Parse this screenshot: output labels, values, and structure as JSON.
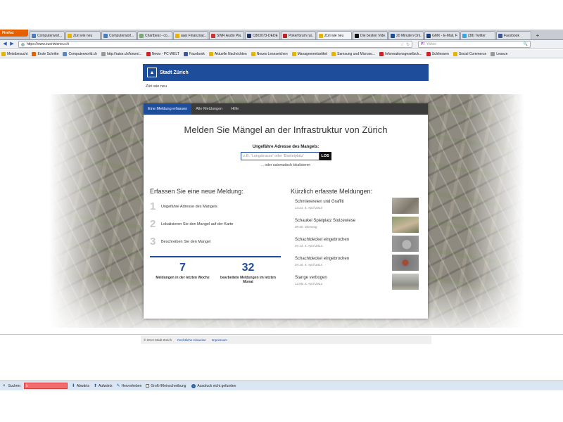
{
  "browser": {
    "app_button": "Firefox",
    "tabs": [
      {
        "title": "Computerworl..."
      },
      {
        "title": "Züri wie neu"
      },
      {
        "title": "Computerworl..."
      },
      {
        "title": "Chartbeat - co..."
      },
      {
        "title": "awp Finanznac..."
      },
      {
        "title": "SWR Audio Pla..."
      },
      {
        "title": "C803073-DEDE..."
      },
      {
        "title": "Pokerforum rai..."
      },
      {
        "title": "Züri wie neu"
      },
      {
        "title": "Die besten Vide..."
      },
      {
        "title": "20 Minuten Onl..."
      },
      {
        "title": "GMX - E-Mail, F..."
      },
      {
        "title": "(38) Twitter"
      },
      {
        "title": "Facebook"
      }
    ],
    "new_tab": "+",
    "url": "https://www.zueriwieneu.ch",
    "search_placeholder": "Yahoo",
    "search_engine": "Y!",
    "bookmarks": [
      {
        "label": "Meistbesucht"
      },
      {
        "label": "Erste Schritte"
      },
      {
        "label": "Computerworld.ch"
      },
      {
        "label": "http://raise.ch/forum/..."
      },
      {
        "label": "News - PC-WELT"
      },
      {
        "label": "Facebook"
      },
      {
        "label": "Aktuelle Nachrichten"
      },
      {
        "label": "Neues Lesezeichen"
      },
      {
        "label": "Managementartikel"
      },
      {
        "label": "Samsung und Microso..."
      },
      {
        "label": "Informationsgesellsch..."
      },
      {
        "label": "Schliessen"
      },
      {
        "label": "Social Commerce"
      },
      {
        "label": "Leseze"
      }
    ]
  },
  "site": {
    "header_title": "Stadt Zürich",
    "subtitle": "Züri wie neu",
    "nav": [
      {
        "label": "Eine Meldung erfassen"
      },
      {
        "label": "Alle Meldungen"
      },
      {
        "label": "Hilfe"
      }
    ],
    "headline": "Melden Sie Mängel an der Infrastruktur von Zürich",
    "address_label": "Ungefähre Adresse des Mangels:",
    "address_placeholder": "z.B. 'Langstrasse' oder 'Basteiplatz'",
    "go_button": "LOS",
    "auto_locate": "... oder automatisch lokalisieren",
    "left_heading": "Erfassen Sie eine neue Meldung:",
    "steps": [
      {
        "num": "1",
        "text": "Ungefähre Adresse des Mangels"
      },
      {
        "num": "2",
        "text": "Lokalisieren Sie den Mangel auf der Karte"
      },
      {
        "num": "3",
        "text": "Beschreiben Sie den Mangel"
      }
    ],
    "stats": [
      {
        "value": "7",
        "label": "Meldungen in der letzten Woche"
      },
      {
        "value": "32",
        "label": "bearbeitete Meldungen im letzten Monat"
      }
    ],
    "right_heading": "Kürzlich erfasste Meldungen:",
    "reports": [
      {
        "title": "Schmierereien und Graffiti",
        "date": "13:21, 4. April 2013"
      },
      {
        "title": "Schaukel Spielplatz Stolzewiese",
        "date": "09:40, Dienstag"
      },
      {
        "title": "Schachtdeckel eingebrochen",
        "date": "07:13, 4. April 2013"
      },
      {
        "title": "Schachtdeckel eingebrochen",
        "date": "07:15, 4. April 2013"
      },
      {
        "title": "Stange verbogen",
        "date": "12:08, 3. April 2013"
      }
    ],
    "footer": {
      "copyright": "© 2013 Stadt Zürich",
      "link1": "Rechtliche Hinweise",
      "link2": "Impressum"
    }
  },
  "findbar": {
    "close": "×",
    "label": "Suchen:",
    "value": "b",
    "down": "Abwärts",
    "up": "Aufwärts",
    "highlight": "Hervorheben",
    "case": "Groß-/Kleinschreibung",
    "status": "Ausdruck nicht gefunden"
  },
  "colors": {
    "brand_blue": "#1e4d9c",
    "find_error": "#f46b6b"
  }
}
